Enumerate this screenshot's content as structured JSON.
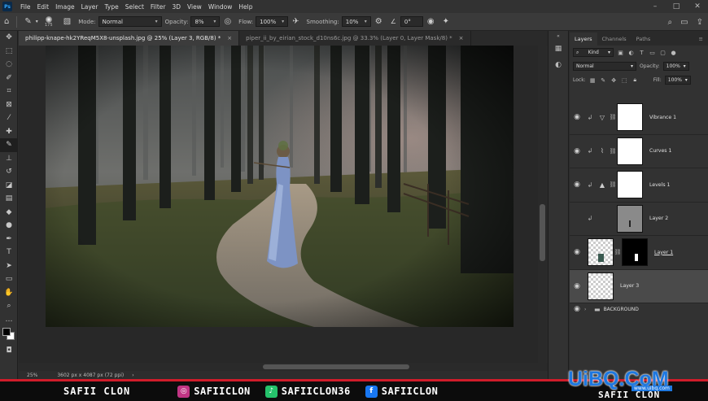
{
  "menu": {
    "logo": "Ps",
    "items": [
      "File",
      "Edit",
      "Image",
      "Layer",
      "Type",
      "Select",
      "Filter",
      "3D",
      "View",
      "Window",
      "Help"
    ]
  },
  "options": {
    "brush_size": "175",
    "mode_label": "Mode:",
    "mode_value": "Normal",
    "opacity_label": "Opacity:",
    "opacity_value": "8%",
    "flow_label": "Flow:",
    "flow_value": "100%",
    "smoothing_label": "Smoothing:",
    "smoothing_value": "10%",
    "angle_value": "0°"
  },
  "tabs": [
    {
      "label": "philipp-knape-hk2YReqM5X8-unsplash.jpg @ 25% (Layer 3, RGB/8) *",
      "close": "×"
    },
    {
      "label": "piper_ii_by_eirian_stock_d10ns6c.jpg @ 33.3% (Layer 0, Layer Mask/8) *",
      "close": "×"
    }
  ],
  "status": {
    "zoom": "25%",
    "doc_size": "3602 px x 4087 px (72 ppi)"
  },
  "panel": {
    "tabs": [
      "Layers",
      "Channels",
      "Paths"
    ],
    "kind_label": "Kind",
    "blend_mode": "Normal",
    "opacity_label": "Opacity:",
    "opacity_value": "100%",
    "lock_label": "Lock:",
    "fill_label": "Fill:",
    "fill_value": "100%",
    "layers": [
      {
        "name": "Vibrance 1",
        "type": "adjustment",
        "icon": "vibrance-icon"
      },
      {
        "name": "Curves 1",
        "type": "adjustment",
        "icon": "curves-icon"
      },
      {
        "name": "Levels 1",
        "type": "adjustment",
        "icon": "levels-icon"
      },
      {
        "name": "Layer 2",
        "type": "pixel"
      },
      {
        "name": "Layer 1",
        "type": "masked"
      },
      {
        "name": "Layer 3",
        "type": "transparent",
        "selected": true
      }
    ],
    "group_name": "BACKGROUND"
  },
  "banner": {
    "name_left": "SAFII CLON",
    "instagram": "SAFIICLON",
    "tiktok": "SAFIICLON36",
    "facebook": "SAFIICLON",
    "name_right": "SAFII CLON"
  },
  "watermark": {
    "text": "UiBQ.CoM",
    "sub": "www.uibq.com"
  },
  "colors": {
    "accent": "#d01c2a",
    "selection": "#4a4a4a",
    "watermark": "#1e78e0",
    "instagram": "#c13584",
    "tiktok": "#25c26b",
    "facebook": "#1877f2"
  }
}
